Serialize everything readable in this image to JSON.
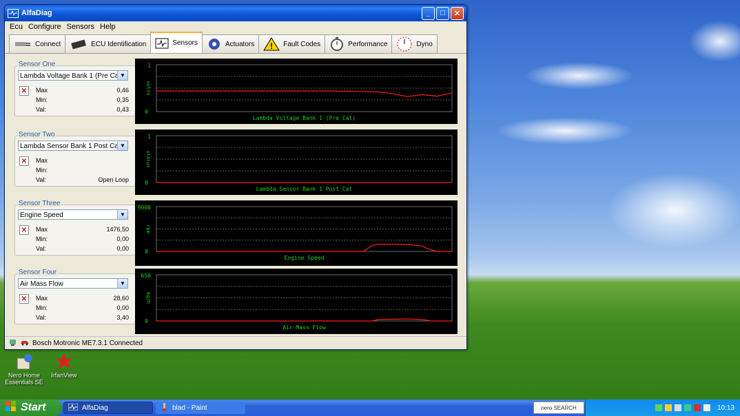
{
  "window": {
    "title": "AlfaDiag"
  },
  "menu": [
    "Ecu",
    "Configure",
    "Sensors",
    "Help"
  ],
  "tabs": [
    {
      "label": "Connect",
      "icon": "plug-icon"
    },
    {
      "label": "ECU Identification",
      "icon": "chip-icon"
    },
    {
      "label": "Sensors",
      "icon": "oscilloscope-icon"
    },
    {
      "label": "Actuators",
      "icon": "gear-icon"
    },
    {
      "label": "Fault Codes",
      "icon": "warning-icon"
    },
    {
      "label": "Performance",
      "icon": "stopwatch-icon"
    },
    {
      "label": "Dyno",
      "icon": "gauge-icon"
    }
  ],
  "sensors": [
    {
      "group": "Sensor One",
      "selected": "Lambda Voltage Bank 1 (Pre Cat)",
      "max_label": "Max",
      "min_label": "Min:",
      "val_label": "Val:",
      "max": "0,46",
      "min": "0,35",
      "val": "0,43"
    },
    {
      "group": "Sensor Two",
      "selected": "Lambda Sensor Bank 1 Post Cat",
      "max_label": "Max",
      "min_label": "Min:",
      "val_label": "Val:",
      "max": "",
      "min": "",
      "val": "Open Loop"
    },
    {
      "group": "Sensor Three",
      "selected": "Engine Speed",
      "max_label": "Max",
      "min_label": "Min:",
      "val_label": "Val:",
      "max": "1476,50",
      "min": "0,00",
      "val": "0,00"
    },
    {
      "group": "Sensor Four",
      "selected": "Air Mass Flow",
      "max_label": "Max",
      "min_label": "Min:",
      "val_label": "Val:",
      "max": "28,60",
      "min": "0,00",
      "val": "3,40"
    }
  ],
  "chart_data": [
    {
      "type": "line",
      "title": "Lambda Voltage Bank 1 (Pre Cat)",
      "ylabel": "volts",
      "yticks": [
        "1",
        "0"
      ],
      "ylim": [
        0,
        1
      ],
      "series": [
        {
          "x": [
            0,
            0.6,
            0.7,
            0.75,
            0.8,
            0.85,
            0.9,
            0.95,
            1.0
          ],
          "y": [
            0.44,
            0.44,
            0.43,
            0.42,
            0.38,
            0.32,
            0.36,
            0.33,
            0.4
          ]
        }
      ]
    },
    {
      "type": "line",
      "title": "Lambda Sensor Bank 1 Post Cat",
      "ylabel": "status",
      "yticks": [
        "1",
        "0"
      ],
      "ylim": [
        0,
        1
      ],
      "series": [
        {
          "x": [
            0,
            1.0
          ],
          "y": [
            0,
            0
          ]
        }
      ]
    },
    {
      "type": "line",
      "title": "Engine Speed",
      "ylabel": "rpm",
      "yticks": [
        "9000",
        "0"
      ],
      "ylim": [
        0,
        9000
      ],
      "series": [
        {
          "x": [
            0,
            0.7,
            0.73,
            0.75,
            0.85,
            0.9,
            0.92,
            0.95,
            1.0
          ],
          "y": [
            0,
            0,
            1200,
            1450,
            1400,
            1050,
            500,
            0,
            0
          ]
        }
      ]
    },
    {
      "type": "line",
      "title": "Air Mass Flow",
      "ylabel": "kg/h",
      "yticks": [
        "650",
        "0"
      ],
      "ylim": [
        0,
        650
      ],
      "series": [
        {
          "x": [
            0,
            0.73,
            0.75,
            0.85,
            0.9,
            0.93,
            1.0
          ],
          "y": [
            0,
            0,
            20,
            28,
            20,
            0,
            0
          ]
        }
      ]
    }
  ],
  "status": {
    "text": "Bosch Motronic ME7.3.1 Connected"
  },
  "desktop_icons": [
    {
      "label": "Nero Home Essentials SE"
    },
    {
      "label": "IrfanView"
    }
  ],
  "taskbar": {
    "start": "Start",
    "items": [
      "AlfaDiag",
      "blad - Paint"
    ],
    "nero": "nero SEARCH",
    "clock": "10:13"
  },
  "colors": {
    "plot_line": "#ff1a1a",
    "plot_text": "#1dd11d",
    "plot_bg": "#000000"
  }
}
